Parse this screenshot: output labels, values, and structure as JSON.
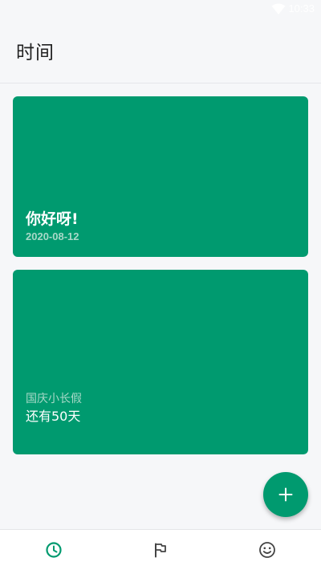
{
  "status_bar": {
    "time": "10:33",
    "wifi_icon": "wifi-icon"
  },
  "header": {
    "title": "时间"
  },
  "cards": [
    {
      "title": "你好呀!",
      "date": "2020-08-12",
      "color": "#009a6f"
    },
    {
      "subtitle": "国庆小长假",
      "countdown": "还有50天",
      "color": "#009a6f"
    }
  ],
  "fab": {
    "icon": "plus-icon"
  },
  "bottom_nav": {
    "items": [
      {
        "icon": "clock-icon",
        "active": true
      },
      {
        "icon": "flag-icon",
        "active": false
      },
      {
        "icon": "smiley-icon",
        "active": false
      }
    ],
    "active_color": "#009a6f",
    "inactive_color": "#444444"
  },
  "colors": {
    "accent": "#009a6f",
    "background": "#f6f7f9"
  }
}
